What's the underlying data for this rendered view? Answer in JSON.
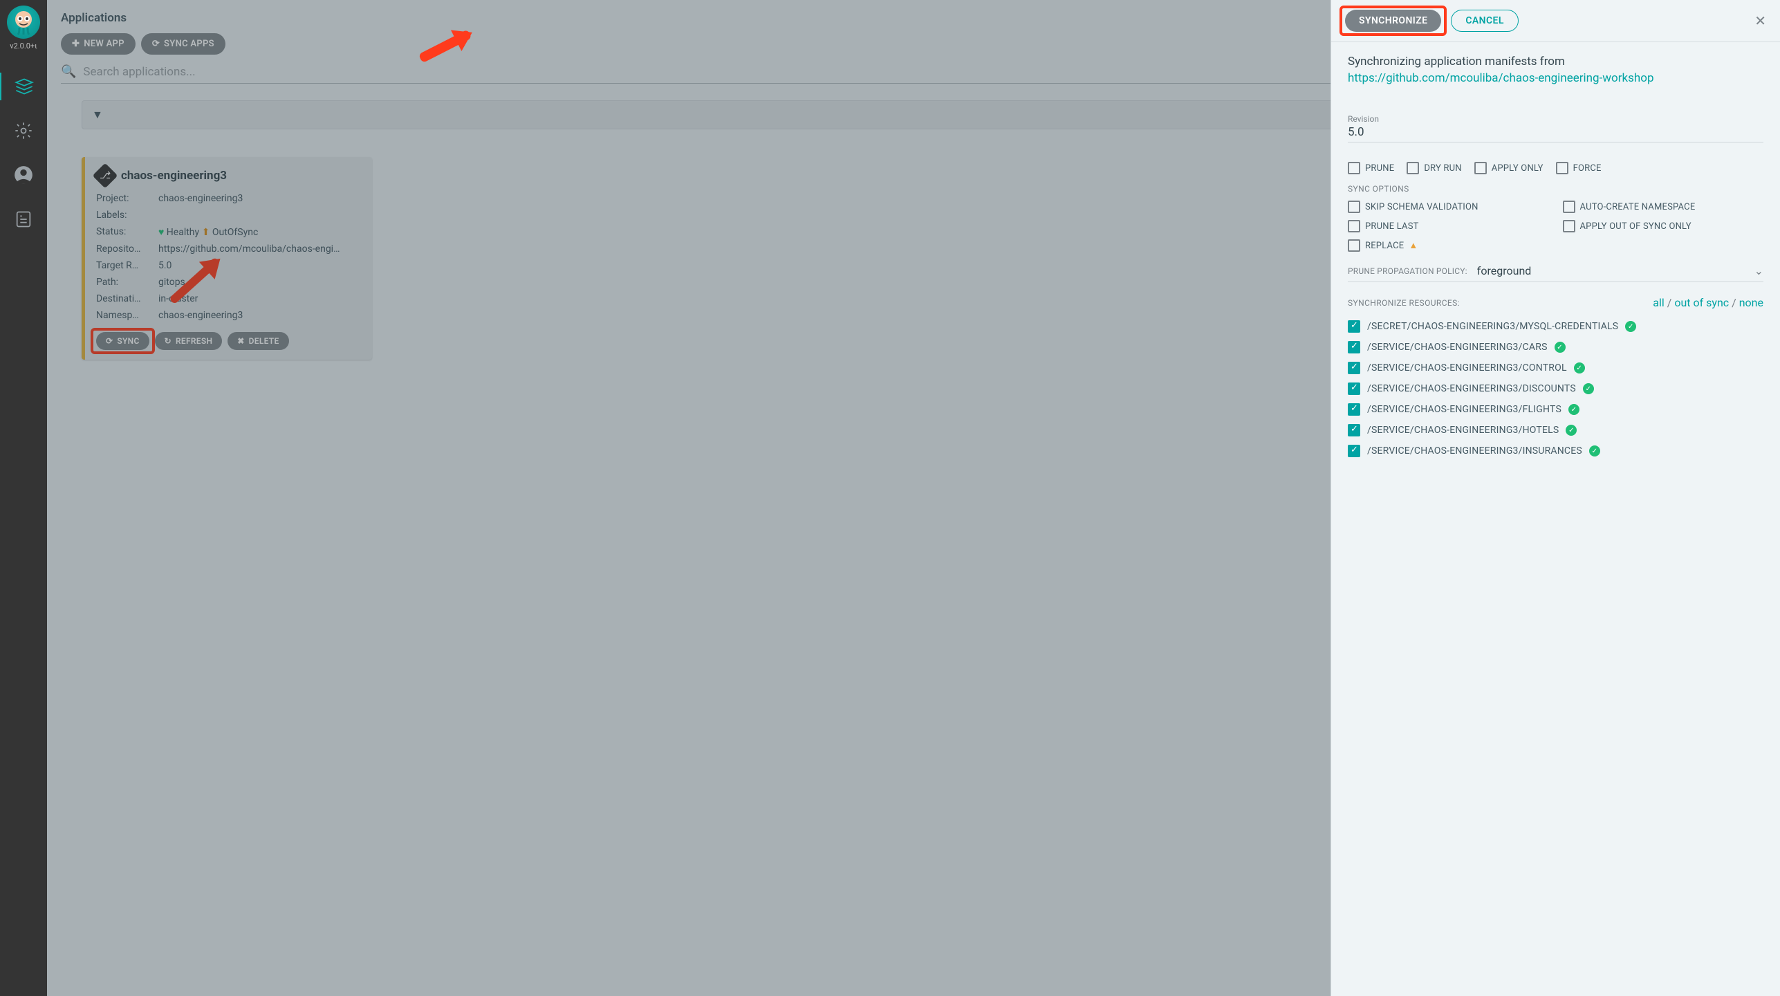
{
  "sidebar": {
    "version": "v2.0.0+ι"
  },
  "page": {
    "title": "Applications",
    "new_app": "NEW APP",
    "sync_apps": "SYNC APPS",
    "search_placeholder": "Search applications..."
  },
  "card": {
    "name": "chaos-engineering3",
    "rows": {
      "project_k": "Project:",
      "project_v": "chaos-engineering3",
      "labels_k": "Labels:",
      "labels_v": "",
      "status_k": "Status:",
      "status_healthy": "Healthy",
      "status_sync": "OutOfSync",
      "repo_k": "Reposito…",
      "repo_v": "https://github.com/mcouliba/chaos-engi…",
      "target_k": "Target R…",
      "target_v": "5.0",
      "path_k": "Path:",
      "path_v": "gitops",
      "dest_k": "Destinati…",
      "dest_v": "in-cluster",
      "ns_k": "Namesp…",
      "ns_v": "chaos-engineering3"
    },
    "actions": {
      "sync": "SYNC",
      "refresh": "REFRESH",
      "delete": "DELETE"
    }
  },
  "panel": {
    "synchronize_btn": "SYNCHRONIZE",
    "cancel_btn": "CANCEL",
    "sync_msg": "Synchronizing application manifests from",
    "sync_url": "https://github.com/mcouliba/chaos-engineering-workshop",
    "revision_lbl": "Revision",
    "revision_val": "5.0",
    "opts": {
      "prune": "PRUNE",
      "dryrun": "DRY RUN",
      "apply_only": "APPLY ONLY",
      "force": "FORCE"
    },
    "sync_options_lbl": "SYNC OPTIONS",
    "sync_options": {
      "skip_schema": "SKIP SCHEMA VALIDATION",
      "auto_ns": "AUTO-CREATE NAMESPACE",
      "prune_last": "PRUNE LAST",
      "apply_oos": "APPLY OUT OF SYNC ONLY",
      "replace": "REPLACE"
    },
    "policy_lbl": "PRUNE PROPAGATION POLICY:",
    "policy_val": "foreground",
    "res_lbl": "SYNCHRONIZE RESOURCES:",
    "res_links": {
      "all": "all",
      "oos": "out of sync",
      "none": "none"
    },
    "resources": [
      "/SECRET/CHAOS-ENGINEERING3/MYSQL-CREDENTIALS",
      "/SERVICE/CHAOS-ENGINEERING3/CARS",
      "/SERVICE/CHAOS-ENGINEERING3/CONTROL",
      "/SERVICE/CHAOS-ENGINEERING3/DISCOUNTS",
      "/SERVICE/CHAOS-ENGINEERING3/FLIGHTS",
      "/SERVICE/CHAOS-ENGINEERING3/HOTELS",
      "/SERVICE/CHAOS-ENGINEERING3/INSURANCES"
    ]
  }
}
